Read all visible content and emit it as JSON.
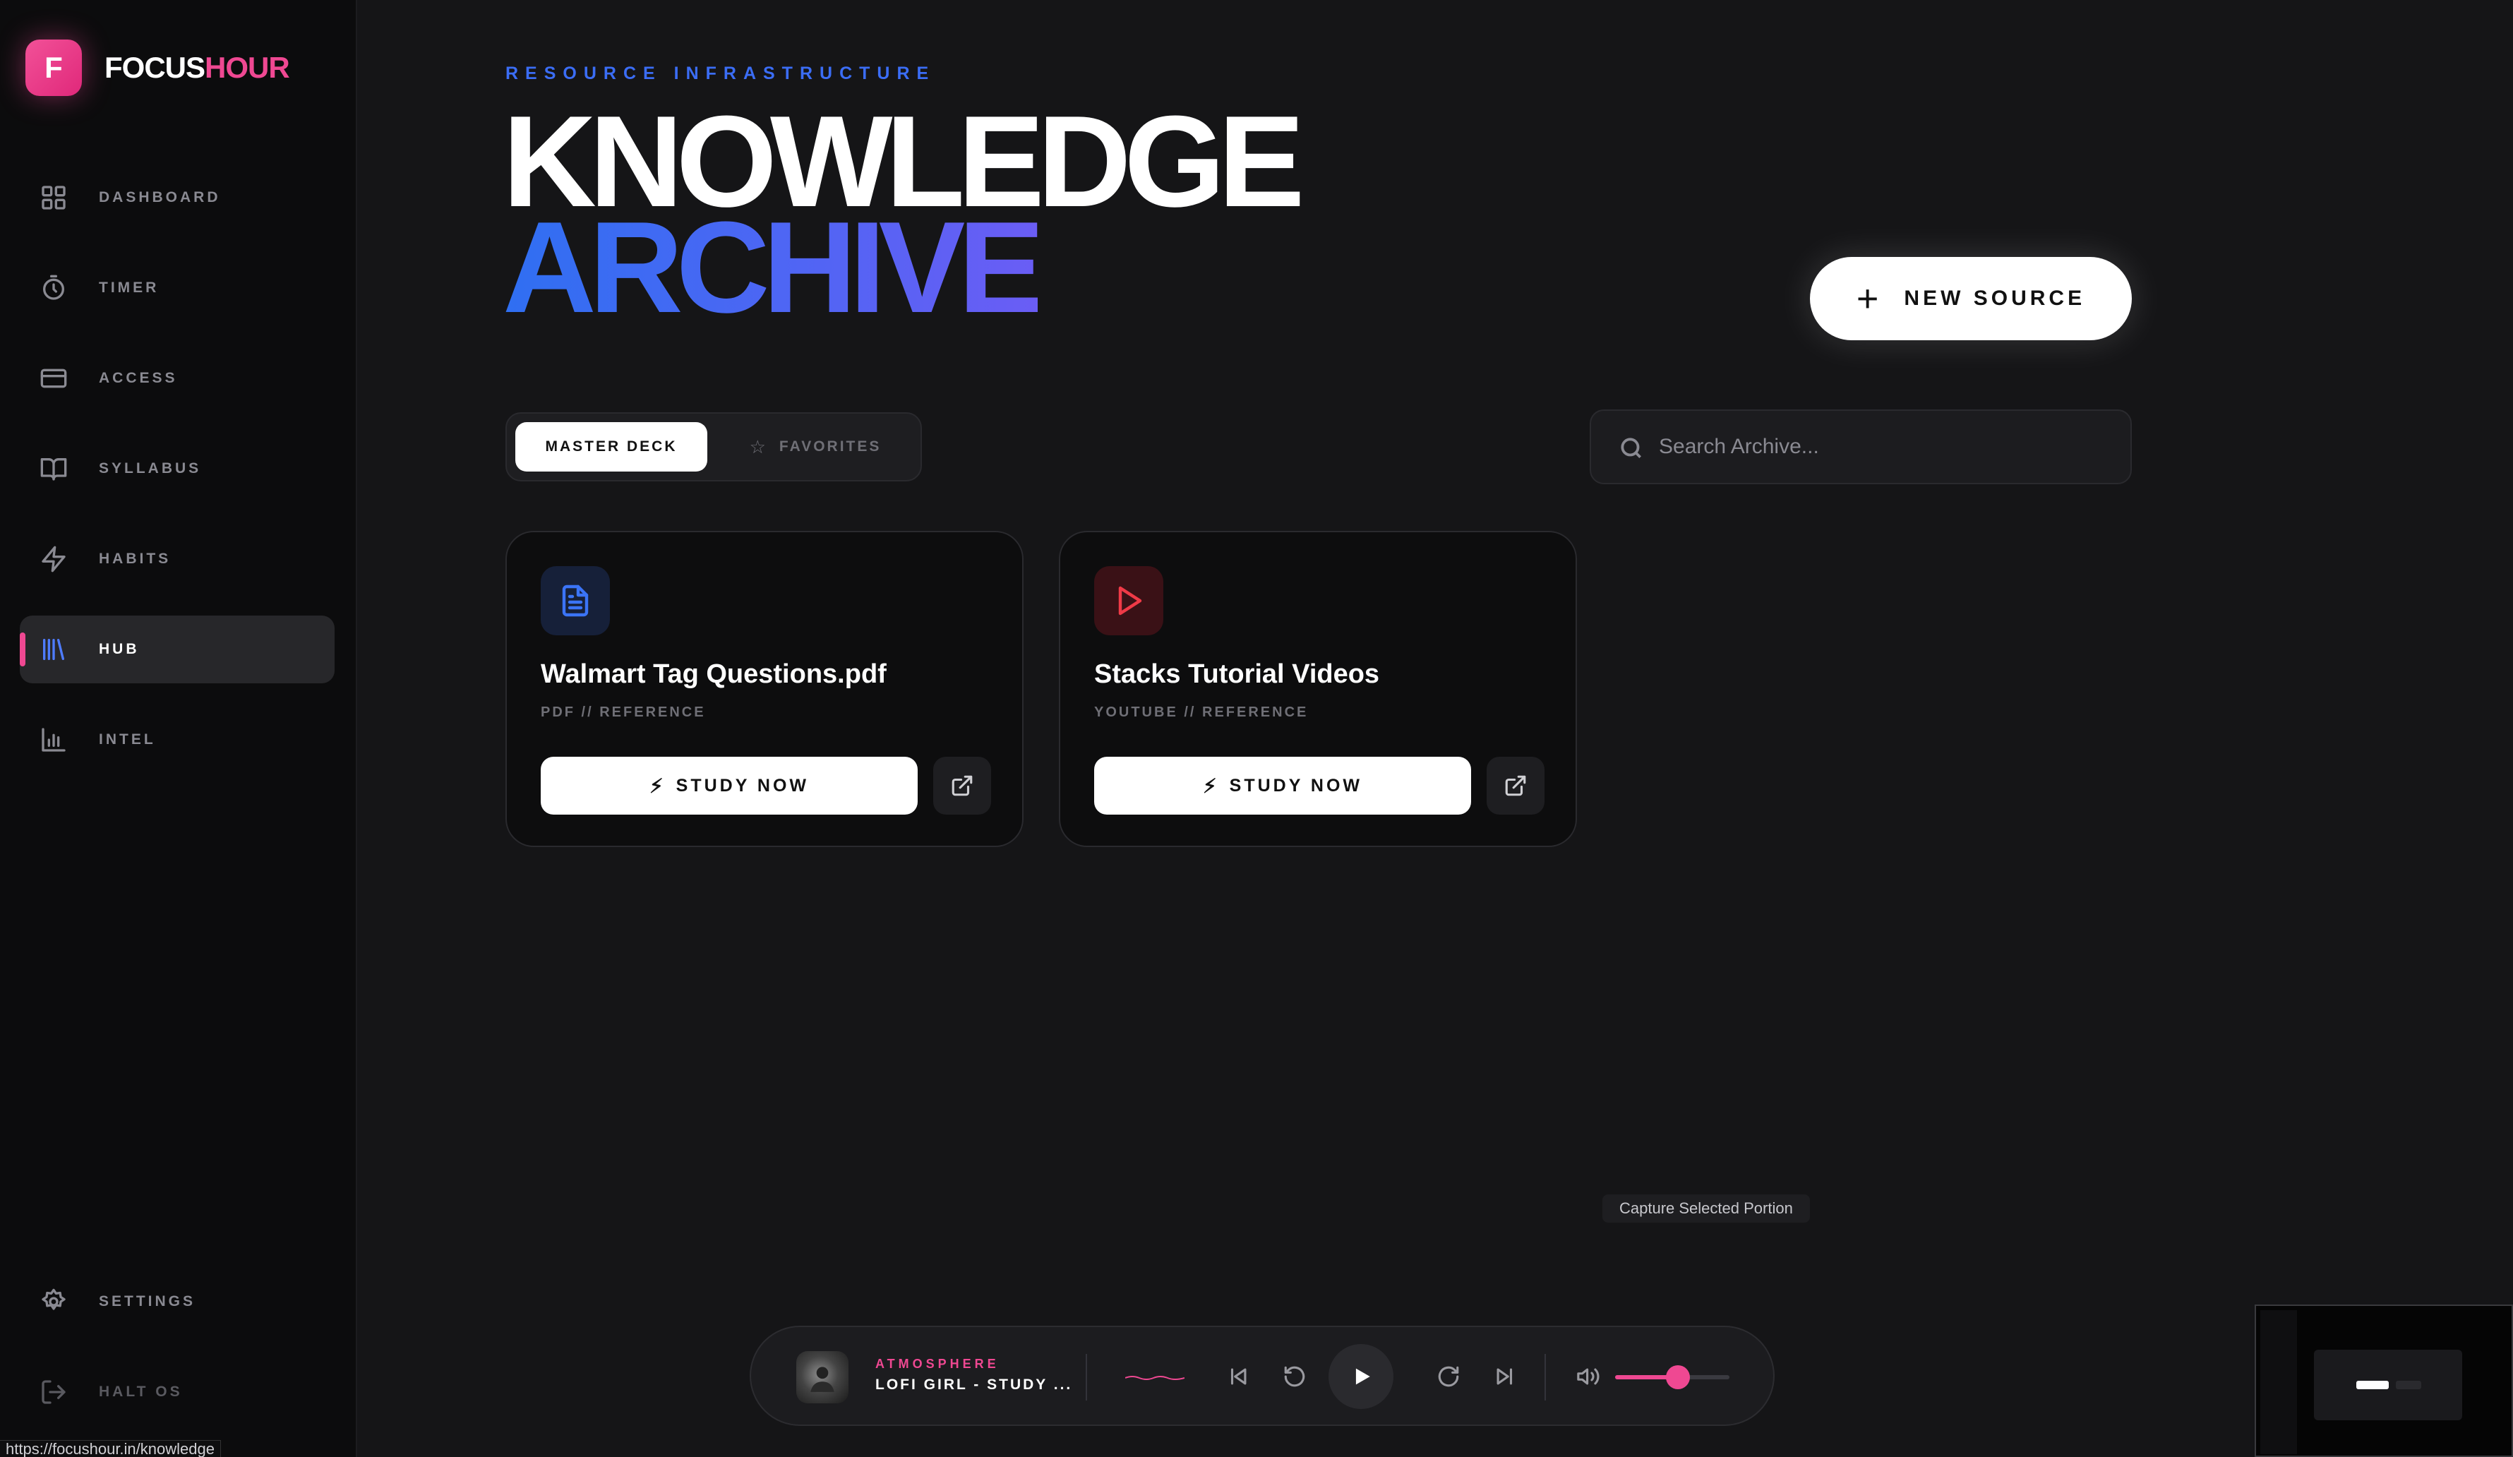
{
  "brand": {
    "letter": "F",
    "name_a": "FOCUS",
    "name_b": "HOUR",
    "accent": "#ef4892"
  },
  "sidebar": {
    "items": [
      {
        "label": "DASHBOARD",
        "icon": "grid-icon"
      },
      {
        "label": "TIMER",
        "icon": "stopwatch-icon"
      },
      {
        "label": "ACCESS",
        "icon": "credit-card-icon"
      },
      {
        "label": "SYLLABUS",
        "icon": "book-icon"
      },
      {
        "label": "HABITS",
        "icon": "lightning-icon"
      },
      {
        "label": "HUB",
        "icon": "library-icon",
        "active": true
      },
      {
        "label": "INTEL",
        "icon": "bar-chart-icon"
      }
    ],
    "footer": [
      {
        "label": "SETTINGS",
        "icon": "gear-icon"
      },
      {
        "label": "HALT OS",
        "icon": "logout-icon"
      }
    ]
  },
  "header": {
    "eyebrow": "RESOURCE INFRASTRUCTURE",
    "title_line1": "KNOWLEDGE",
    "title_line2": "ARCHIVE",
    "new_source_label": "NEW SOURCE"
  },
  "tabs": [
    {
      "label": "MASTER DECK",
      "active": true
    },
    {
      "label": "FAVORITES",
      "active": false
    }
  ],
  "search": {
    "placeholder": "Search Archive..."
  },
  "cards": [
    {
      "title": "Walmart Tag Questions.pdf",
      "subtitle": "PDF // REFERENCE",
      "icon": "document-icon",
      "action": "STUDY NOW"
    },
    {
      "title": "Stacks Tutorial Videos",
      "subtitle": "YOUTUBE // REFERENCE",
      "icon": "play-icon",
      "action": "STUDY NOW"
    }
  ],
  "tooltip": "Capture Selected Portion",
  "player": {
    "eyebrow": "ATMOSPHERE",
    "track": "LOFI GIRL - STUDY ...",
    "volume": 0.55
  },
  "status_url": "https://focushour.in/knowledge"
}
